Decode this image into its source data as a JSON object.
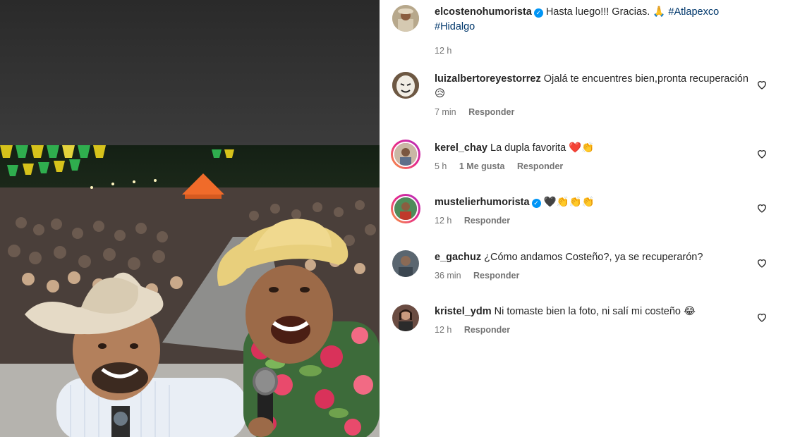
{
  "post": {
    "caption": {
      "username": "elcostenohumorista",
      "verified": true,
      "text": "Hasta luego!!! Gracias. 🙏",
      "hashtags": [
        "#Atlapexco",
        "#Hidalgo"
      ],
      "time": "12 h"
    }
  },
  "comments": [
    {
      "username": "luizalbertoreyestorrez",
      "verified": false,
      "text": "Ojalá te encuentres bien,pronta recuperación 😥",
      "time": "7 min",
      "likes": "",
      "reply_label": "Responder",
      "avatar_icon": "mask-avatar-icon",
      "story_ring": false
    },
    {
      "username": "kerel_chay",
      "verified": false,
      "text": "La dupla favorita ❤️👏",
      "time": "5 h",
      "likes": "1 Me gusta",
      "reply_label": "Responder",
      "avatar_icon": "person-avatar-icon",
      "story_ring": true
    },
    {
      "username": "mustelierhumorista",
      "verified": true,
      "text": "🖤👏👏👏",
      "time": "12 h",
      "likes": "",
      "reply_label": "Responder",
      "avatar_icon": "person-avatar-icon",
      "story_ring": true
    },
    {
      "username": "e_gachuz",
      "verified": false,
      "text": "¿Cómo andamos Costeño?, ya se recuperarón?",
      "time": "36 min",
      "likes": "",
      "reply_label": "Responder",
      "avatar_icon": "person-avatar-icon",
      "story_ring": false
    },
    {
      "username": "kristel_ydm",
      "verified": false,
      "text": "Ni tomaste bien la foto, ni salí mi costeño 😂",
      "time": "12 h",
      "likes": "",
      "reply_label": "Responder",
      "avatar_icon": "person-avatar-icon",
      "story_ring": false
    }
  ],
  "colors": {
    "link": "#00376b",
    "verified": "#0095f6",
    "meta": "#737373"
  }
}
